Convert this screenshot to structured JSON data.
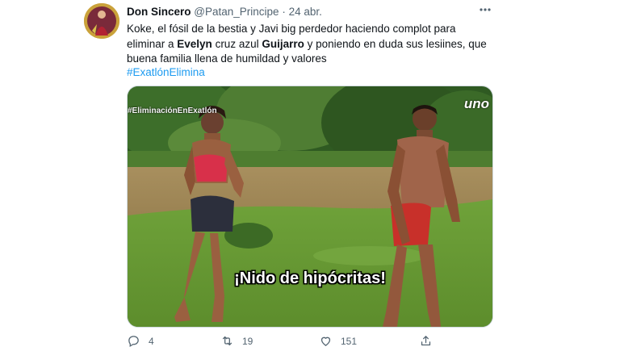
{
  "tweet": {
    "display_name": "Don Sincero",
    "handle": "@Patan_Principe",
    "separator": "·",
    "date": "24 abr.",
    "text_1": "Koke, el fósil de la bestia y Javi big perdedor haciendo complot para eliminar a ",
    "text_bold_1": "Evelyn",
    "text_2": " cruz azul ",
    "text_bold_2": "Guijarro",
    "text_3": " y poniendo en duda sus lesiines, que buena familia llena de humildad y valores",
    "hashtag": "#ExatlónElimina"
  },
  "media": {
    "overlay_hashtag": "#EliminaciónEnExatlón",
    "logo": "uno",
    "subtitle": "¡Nido de hipócritas!"
  },
  "actions": {
    "replies": "4",
    "retweets": "19",
    "likes": "151"
  },
  "colors": {
    "link": "#1d9bf0",
    "muted": "#536471"
  }
}
